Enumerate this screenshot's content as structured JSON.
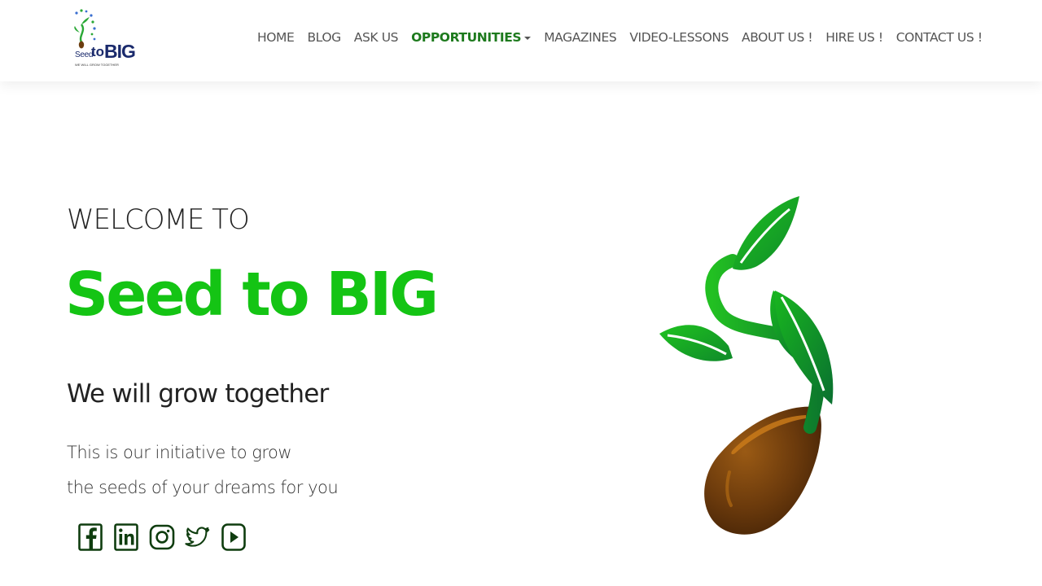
{
  "logo": {
    "seed": "Seed",
    "to": "to",
    "big": "BIG",
    "tagline": "WE WILL GROW TOGETHER"
  },
  "nav": {
    "items": [
      {
        "label": "HOME"
      },
      {
        "label": "BLOG"
      },
      {
        "label": "ASK US"
      },
      {
        "label": "OPPORTUNITIES"
      },
      {
        "label": "MAGAZINES"
      },
      {
        "label": "VIDEO-LESSONS"
      },
      {
        "label": "ABOUT US !"
      },
      {
        "label": "HIRE US !"
      },
      {
        "label": "CONTACT US !"
      }
    ],
    "active_index": 3
  },
  "hero": {
    "welcome": "WELCOME TO",
    "title": "Seed to BIG",
    "subtitle": "We will grow together",
    "text_line1": "This is our initiative to grow",
    "text_line2": "the seeds of your dreams for you"
  },
  "social": [
    {
      "icon": "facebook-icon"
    },
    {
      "icon": "linkedin-icon"
    },
    {
      "icon": "instagram-icon"
    },
    {
      "icon": "twitter-icon"
    },
    {
      "icon": "youtube-icon"
    }
  ],
  "colors": {
    "brand_green": "#14c414",
    "nav_active": "#1d7a1d",
    "logo_blue": "#1a2a6c",
    "text_dark": "#222222",
    "seed_brown": "#6b3d0f"
  }
}
